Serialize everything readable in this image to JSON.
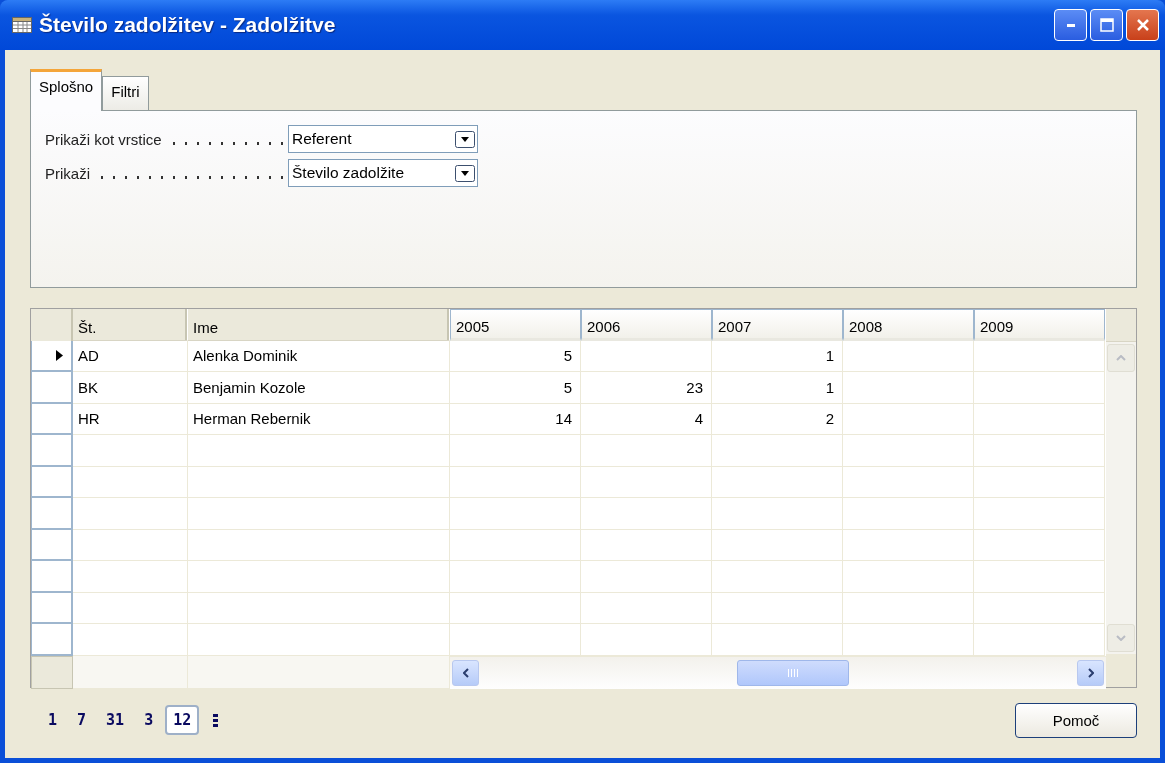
{
  "window": {
    "title": "Število zadolžitev - Zadolžitve"
  },
  "tabs": [
    {
      "label": "Splošno",
      "selected": true
    },
    {
      "label": "Filtri",
      "selected": false
    }
  ],
  "fields": [
    {
      "label": "Prikaži kot vrstice",
      "value": "Referent"
    },
    {
      "label": "Prikaži",
      "value": "Število zadolžite"
    }
  ],
  "table": {
    "columns": [
      "Št.",
      "Ime",
      "2005",
      "2006",
      "2007",
      "2008",
      "2009"
    ],
    "rows": [
      {
        "selected": true,
        "code": "AD",
        "name": "Alenka Dominik",
        "cells": [
          {
            "text": "5"
          },
          {},
          {
            "text": "1"
          },
          {},
          {}
        ]
      },
      {
        "selected": false,
        "code": "BK",
        "name": "Benjamin Kozole",
        "cells": [
          {
            "text": "5"
          },
          {
            "text": "23"
          },
          {
            "text": "1"
          },
          {},
          {}
        ]
      },
      {
        "selected": false,
        "code": "HR",
        "name": "Herman Rebernik",
        "cells": [
          {
            "text": "14"
          },
          {
            "text": "4"
          },
          {
            "text": "2"
          },
          {},
          {}
        ]
      }
    ]
  },
  "periods": [
    {
      "label": "1",
      "selected": false
    },
    {
      "label": "7",
      "selected": false
    },
    {
      "label": "31",
      "selected": false
    },
    {
      "label": "3",
      "selected": false
    },
    {
      "label": "12",
      "selected": true
    }
  ],
  "help_button": "Pomoč"
}
